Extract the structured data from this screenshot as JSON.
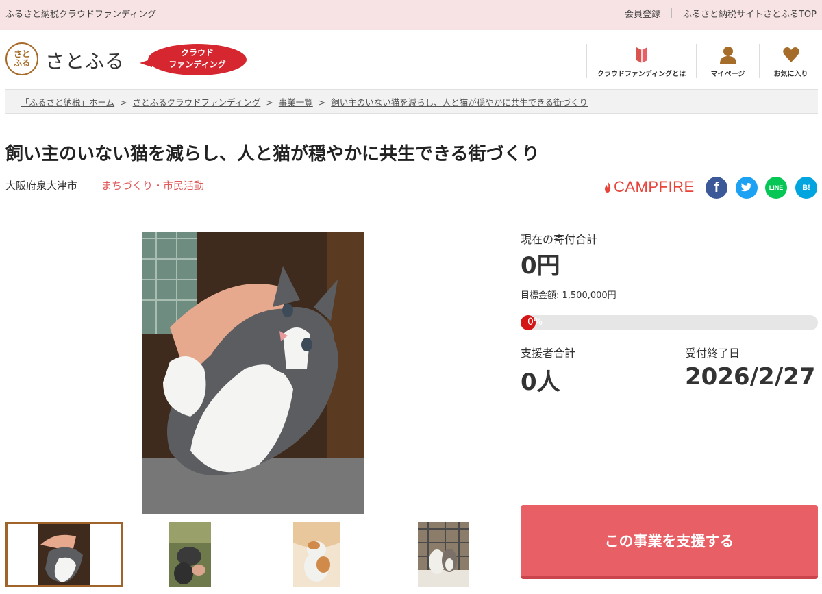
{
  "topbar": {
    "site_name": "ふるさと納税クラウドファンディング",
    "register_link": "会員登録",
    "satofull_top_link": "ふるさと納税サイトさとふるTOP"
  },
  "header": {
    "logo_mark": "さとふる",
    "logo_text": "さとふる",
    "badge_line1": "クラウド",
    "badge_line2": "ファンディング",
    "nav": [
      {
        "label": "クラウドファンディングとは",
        "icon": "book-icon"
      },
      {
        "label": "マイページ",
        "icon": "person-icon"
      },
      {
        "label": "お気に入り",
        "icon": "heart-icon"
      }
    ]
  },
  "breadcrumb": [
    "「ふるさと納税」ホーム",
    "さとふるクラウドファンディング",
    "事業一覧",
    "飼い主のいない猫を減らし、人と猫が穏やかに共生できる街づくり"
  ],
  "project": {
    "title": "飼い主のいない猫を減らし、人と猫が穏やかに共生できる街づくり",
    "location": "大阪府泉大津市",
    "category": "まちづくり・市民活動",
    "platform": "CAMPFIRE"
  },
  "social": {
    "facebook": "f",
    "twitter": "t",
    "line": "LINE",
    "hatena": "B!"
  },
  "stats": {
    "current_label": "現在の寄付合計",
    "current_value": "0円",
    "goal_text": "目標金額: 1,500,000円",
    "progress_text": "0%",
    "progress": 0,
    "supporters_label": "支援者合計",
    "supporters_value": "0人",
    "deadline_label": "受付終了日",
    "deadline_value": "2026/2/27"
  },
  "support_button": "この事業を支援する",
  "colors": {
    "accent_red": "#e86065",
    "brand_brown": "#a66c2a",
    "topbar_pink": "#f7e3e3",
    "category_red": "#e05a5a"
  }
}
